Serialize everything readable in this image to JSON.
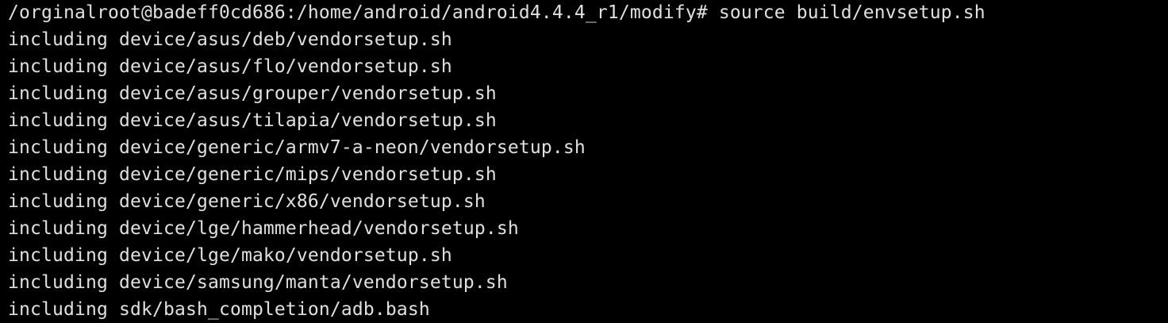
{
  "colors": {
    "background": "#000000",
    "text": "#e0e0e0"
  },
  "terminal": {
    "prompt_line": "/orginalroot@badeff0cd686:/home/android/android4.4.4_r1/modify# source build/envsetup.sh",
    "output_lines": [
      "including device/asus/deb/vendorsetup.sh",
      "including device/asus/flo/vendorsetup.sh",
      "including device/asus/grouper/vendorsetup.sh",
      "including device/asus/tilapia/vendorsetup.sh",
      "including device/generic/armv7-a-neon/vendorsetup.sh",
      "including device/generic/mips/vendorsetup.sh",
      "including device/generic/x86/vendorsetup.sh",
      "including device/lge/hammerhead/vendorsetup.sh",
      "including device/lge/mako/vendorsetup.sh",
      "including device/samsung/manta/vendorsetup.sh",
      "including sdk/bash_completion/adb.bash"
    ]
  }
}
